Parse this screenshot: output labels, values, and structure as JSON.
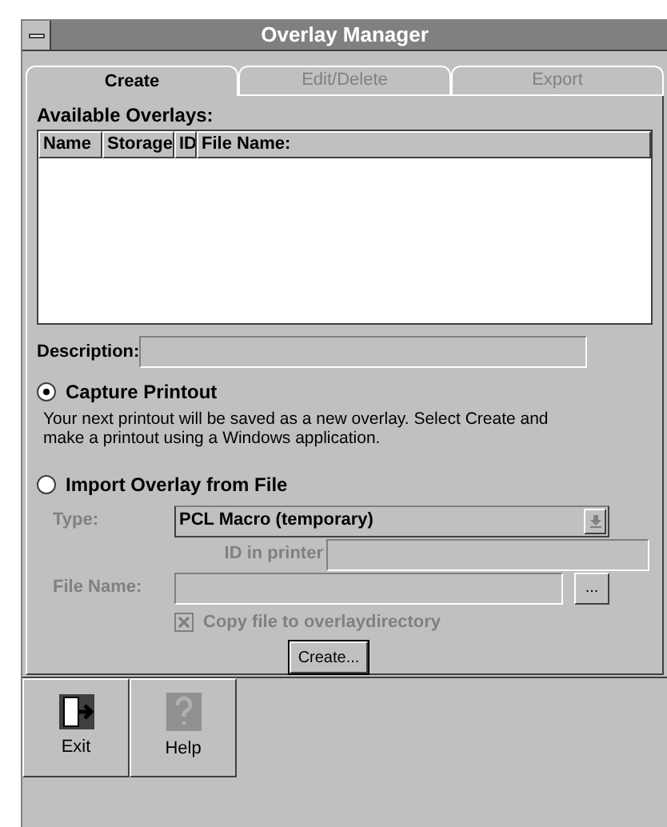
{
  "window": {
    "title": "Overlay Manager"
  },
  "tabs": [
    {
      "label": "Create",
      "selected": true,
      "disabled": false
    },
    {
      "label": "Edit/Delete",
      "selected": false,
      "disabled": true
    },
    {
      "label": "Export",
      "selected": false,
      "disabled": true
    }
  ],
  "overlays": {
    "label": "Available Overlays:",
    "columns": [
      "Name",
      "Storage",
      "ID",
      "File Name:"
    ]
  },
  "description": {
    "label": "Description:"
  },
  "options": [
    {
      "label": "Capture Printout",
      "selected": true,
      "text": "Your next printout will be saved as a new overlay. Select Create and make a printout using a Windows application."
    },
    {
      "label": "Import Overlay from File",
      "selected": false
    }
  ],
  "import": {
    "disabled": true,
    "type_label": "Type:",
    "type_value": "PCL Macro (temporary)",
    "id_label": "ID in printer",
    "file_label": "File Name:",
    "browse_button": "...",
    "copy": {
      "label": "Copy file to overlaydirectory",
      "checked": true
    }
  },
  "create_button": "Create...",
  "toolbar": [
    {
      "kind": "exit",
      "label": "Exit"
    },
    {
      "kind": "help",
      "label": "Help"
    }
  ]
}
